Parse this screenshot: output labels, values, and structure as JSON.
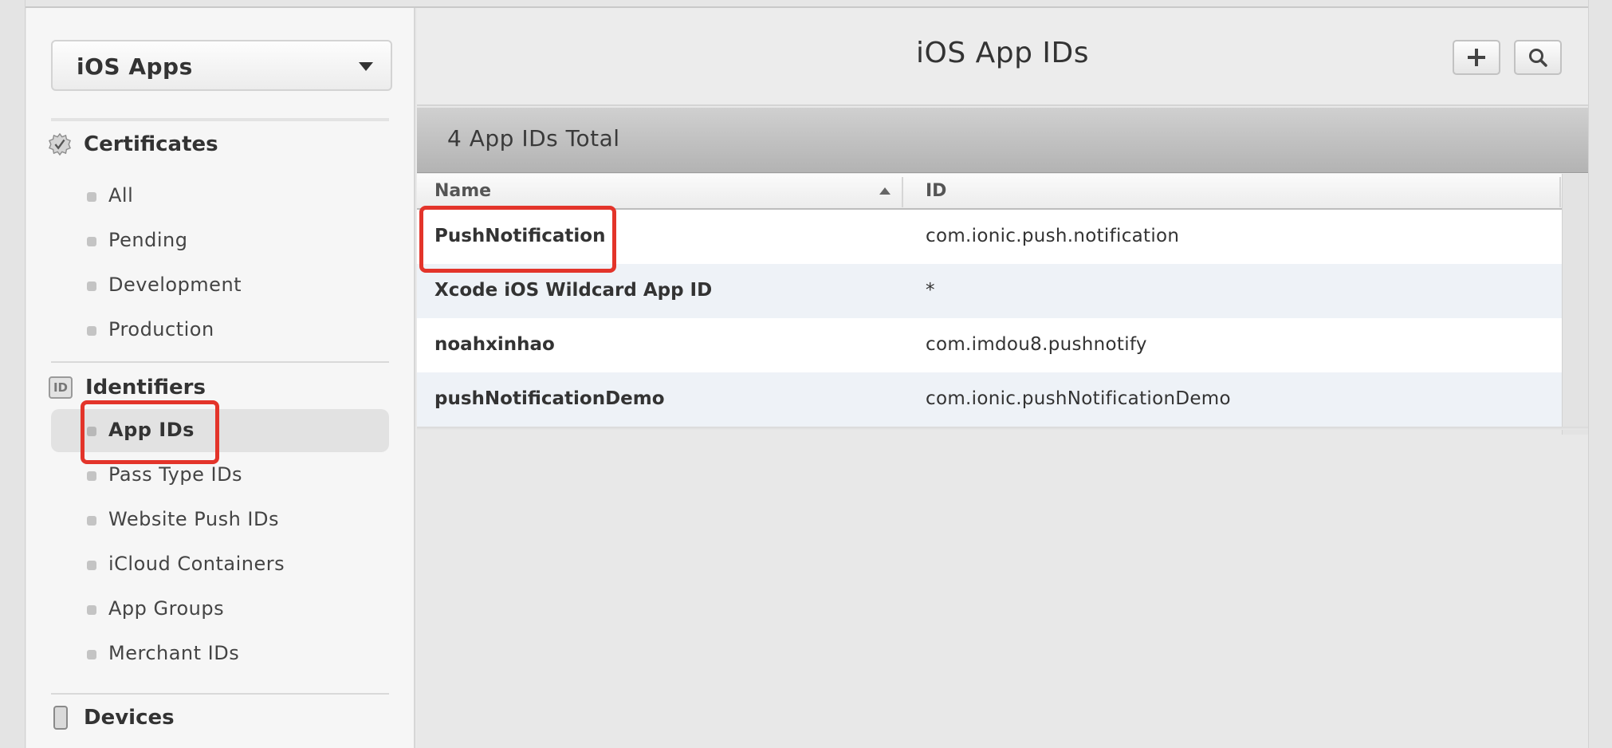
{
  "sidebar": {
    "platform_select": {
      "value": "iOS Apps"
    },
    "sections": {
      "certificates": {
        "title": "Certificates",
        "items": [
          "All",
          "Pending",
          "Development",
          "Production"
        ]
      },
      "identifiers": {
        "title": "Identifiers",
        "icon_text": "ID",
        "items": [
          "App IDs",
          "Pass Type IDs",
          "Website Push IDs",
          "iCloud Containers",
          "App Groups",
          "Merchant IDs"
        ],
        "active_item": "App IDs"
      },
      "devices": {
        "title": "Devices"
      }
    }
  },
  "main": {
    "title": "iOS App IDs",
    "buttons": {
      "add": "plus-icon",
      "search": "search-icon"
    },
    "total_label": "4 App IDs Total",
    "table": {
      "columns": [
        "Name",
        "ID"
      ],
      "sort": {
        "column": "Name",
        "direction": "ascending"
      },
      "rows": [
        {
          "name": "PushNotification",
          "id": "com.ionic.push.notification"
        },
        {
          "name": "Xcode iOS Wildcard App ID",
          "id": "*"
        },
        {
          "name": "noahxinhao",
          "id": "com.imdou8.pushnotify"
        },
        {
          "name": "pushNotificationDemo",
          "id": "com.ionic.pushNotificationDemo"
        }
      ]
    }
  },
  "colors": {
    "highlight": "#e3342a",
    "alt_row": "#eef2f7",
    "active_nav": "#e2e2e2"
  }
}
